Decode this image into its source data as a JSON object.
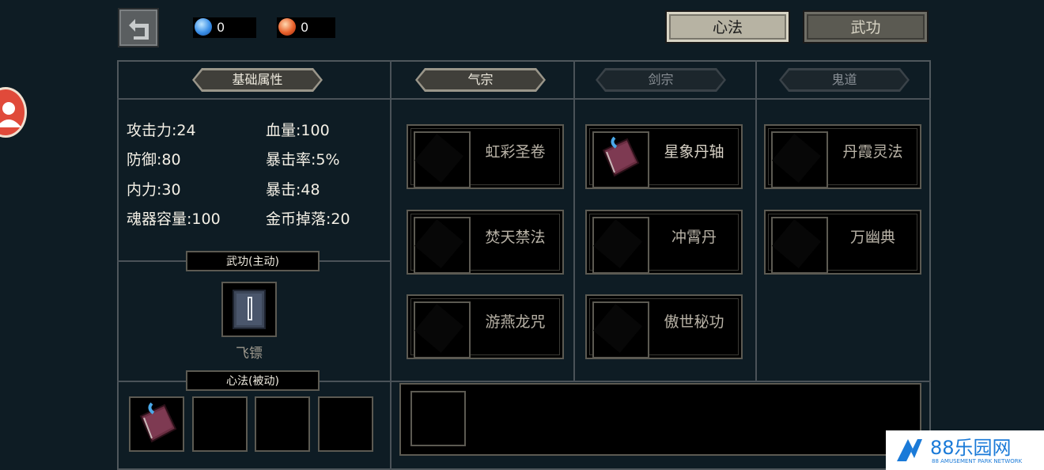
{
  "currencies": [
    {
      "name": "blue-gem",
      "value": "0",
      "color": "#3a8fe8"
    },
    {
      "name": "red-gem",
      "value": "0",
      "color": "#e8602a"
    }
  ],
  "top_tabs": [
    {
      "label": "心法",
      "active": true
    },
    {
      "label": "武功",
      "active": false
    }
  ],
  "base": {
    "title": "基础属性",
    "stats_left": [
      "攻击力:24",
      "防御:80",
      "内力:30",
      "魂器容量:100"
    ],
    "stats_right": [
      "血量:100",
      "暴击率:5%",
      "暴击:48",
      "金币掉落:20"
    ]
  },
  "active_skill": {
    "title": "武功(主动)",
    "item_name": "飞镖"
  },
  "passive_skill": {
    "title": "心法(被动)"
  },
  "schools": [
    {
      "title": "气宗",
      "active": true,
      "items": [
        "虹彩圣卷",
        "焚天禁法",
        "游燕龙咒"
      ]
    },
    {
      "title": "剑宗",
      "active": false,
      "items": [
        "星象丹轴",
        "冲霄丹",
        "傲世秘功"
      ]
    },
    {
      "title": "鬼道",
      "active": false,
      "items": [
        "丹霞灵法",
        "万幽典"
      ]
    }
  ],
  "watermark": {
    "text": "88乐园网",
    "sub": "88 AMUSEMENT PARK NETWORK"
  }
}
